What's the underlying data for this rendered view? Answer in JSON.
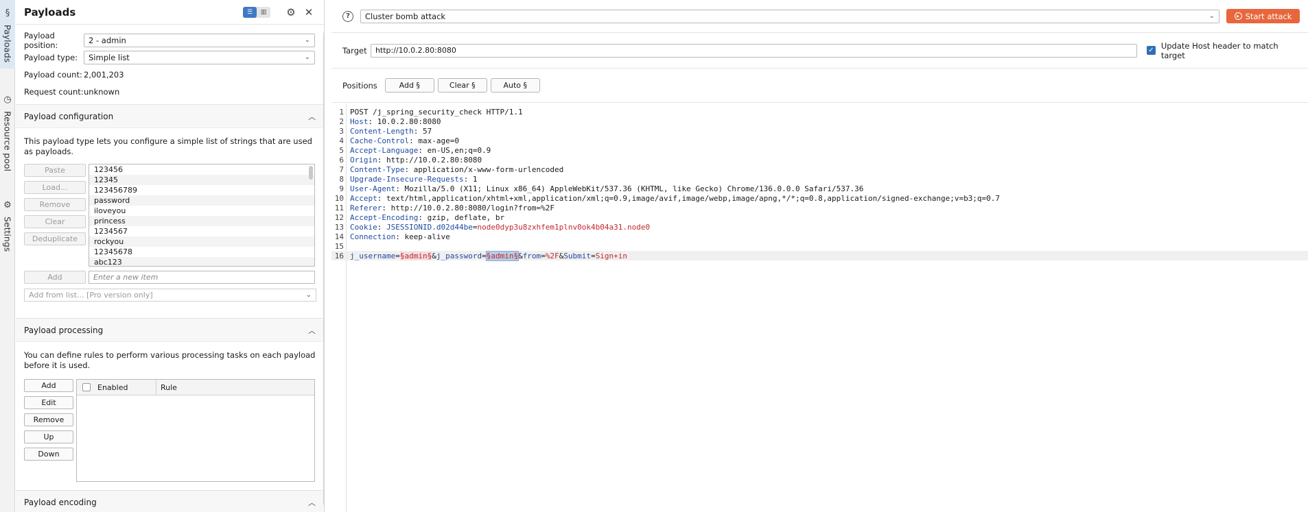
{
  "rail": {
    "tabs": [
      {
        "label": "Payloads",
        "icon": "dollar-icon"
      },
      {
        "label": "Resource pool",
        "icon": "clock-icon"
      },
      {
        "label": "Settings",
        "icon": "gear-icon"
      }
    ]
  },
  "left": {
    "title": "Payloads",
    "fields": {
      "position_label": "Payload position:",
      "position_value": "2 - admin",
      "type_label": "Payload type:",
      "type_value": "Simple list",
      "count_label": "Payload count:",
      "count_value": "2,001,203",
      "request_label": "Request count:",
      "request_value": "unknown"
    },
    "config": {
      "title": "Payload configuration",
      "desc": "This payload type lets you configure a simple list of strings that are used as payloads.",
      "buttons": [
        "Paste",
        "Load...",
        "Remove",
        "Clear",
        "Deduplicate"
      ],
      "items": [
        "123456",
        "12345",
        "123456789",
        "password",
        "iloveyou",
        "princess",
        "1234567",
        "rockyou",
        "12345678",
        "abc123"
      ],
      "add_label": "Add",
      "add_placeholder": "Enter a new item",
      "from_list": "Add from list... [Pro version only]"
    },
    "processing": {
      "title": "Payload processing",
      "desc": "You can define rules to perform various processing tasks on each payload before it is used.",
      "buttons": [
        "Add",
        "Edit",
        "Remove",
        "Up",
        "Down"
      ],
      "col_enabled": "Enabled",
      "col_rule": "Rule"
    },
    "encoding": {
      "title": "Payload encoding"
    }
  },
  "right": {
    "attack_type": "Cluster bomb attack",
    "start_label": "Start attack",
    "target_label": "Target",
    "target_value": "http://10.0.2.80:8080",
    "update_host_label": "Update Host header to match target",
    "positions_label": "Positions",
    "pos_buttons": [
      "Add §",
      "Clear §",
      "Auto §"
    ],
    "request_lines": [
      {
        "n": "1",
        "k": "POST /j_spring_security_check HTTP/1.1",
        "v": ""
      },
      {
        "n": "2",
        "k": "Host",
        "v": "10.0.2.80:8080"
      },
      {
        "n": "3",
        "k": "Content-Length",
        "v": "57"
      },
      {
        "n": "4",
        "k": "Cache-Control",
        "v": "max-age=0"
      },
      {
        "n": "5",
        "k": "Accept-Language",
        "v": "en-US,en;q=0.9"
      },
      {
        "n": "6",
        "k": "Origin",
        "v": "http://10.0.2.80:8080"
      },
      {
        "n": "7",
        "k": "Content-Type",
        "v": "application/x-www-form-urlencoded"
      },
      {
        "n": "8",
        "k": "Upgrade-Insecure-Requests",
        "v": "1"
      },
      {
        "n": "9",
        "k": "User-Agent",
        "v": "Mozilla/5.0 (X11; Linux x86_64) AppleWebKit/537.36 (KHTML, like Gecko) Chrome/136.0.0.0 Safari/537.36"
      },
      {
        "n": "10",
        "k": "Accept",
        "v": "text/html,application/xhtml+xml,application/xml;q=0.9,image/avif,image/webp,image/apng,*/*;q=0.8,application/signed-exchange;v=b3;q=0.7"
      },
      {
        "n": "11",
        "k": "Referer",
        "v": "http://10.0.2.80:8080/login?from=%2F"
      },
      {
        "n": "12",
        "k": "Accept-Encoding",
        "v": "gzip, deflate, br"
      },
      {
        "n": "13",
        "k": "Cookie",
        "v": ""
      },
      {
        "n": "14",
        "k": "Connection",
        "v": "keep-alive"
      },
      {
        "n": "15",
        "k": "",
        "v": ""
      },
      {
        "n": "16",
        "k": "",
        "v": ""
      }
    ],
    "cookie": {
      "name": "JSESSIONID.d02d44be",
      "eq": "=",
      "value": "node0dyp3u8zxhfem1plnv0ok4b04a31.node0"
    },
    "body": {
      "k1": "j_username",
      "eq": "=",
      "p1": "§admin§",
      "amp1": "&",
      "k2": "j_password",
      "p2": "§admin§",
      "amp2": "&",
      "k3": "from",
      "v3": "%2F",
      "amp3": "&",
      "k4": "Submit",
      "v4": "Sign+in"
    }
  }
}
